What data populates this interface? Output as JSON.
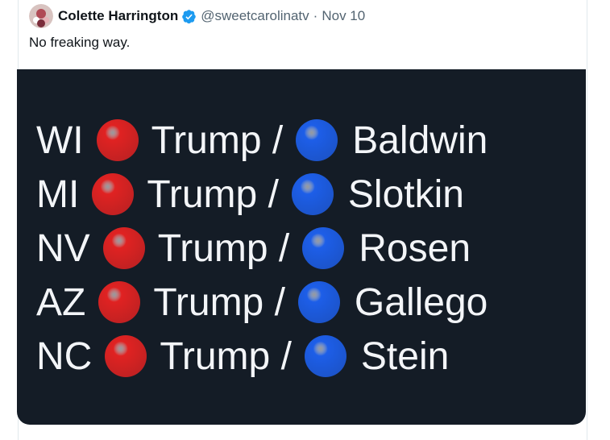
{
  "tweet": {
    "author_name": "Colette Harrington",
    "handle": "@sweetcarolinatv",
    "separator": "·",
    "date": "Nov 10",
    "text": "No freaking way.",
    "verified": true,
    "avatar_icon": "avatar-photo"
  },
  "media": {
    "background_color": "#141c26",
    "text_color": "#f3f5f8",
    "red_color": "#e02222",
    "blue_color": "#1d5ee8",
    "rows": [
      {
        "state": "WI",
        "candidate": "Trump /",
        "senate": "Baldwin"
      },
      {
        "state": "MI",
        "candidate": "Trump /",
        "senate": "Slotkin"
      },
      {
        "state": "NV",
        "candidate": "Trump /",
        "senate": "Rosen"
      },
      {
        "state": "AZ",
        "candidate": "Trump /",
        "senate": "Gallego"
      },
      {
        "state": "NC",
        "candidate": "Trump /",
        "senate": "Stein"
      }
    ]
  },
  "colors": {
    "name": "#0f1419",
    "secondary": "#536471",
    "verified": "#1d9bf0"
  }
}
